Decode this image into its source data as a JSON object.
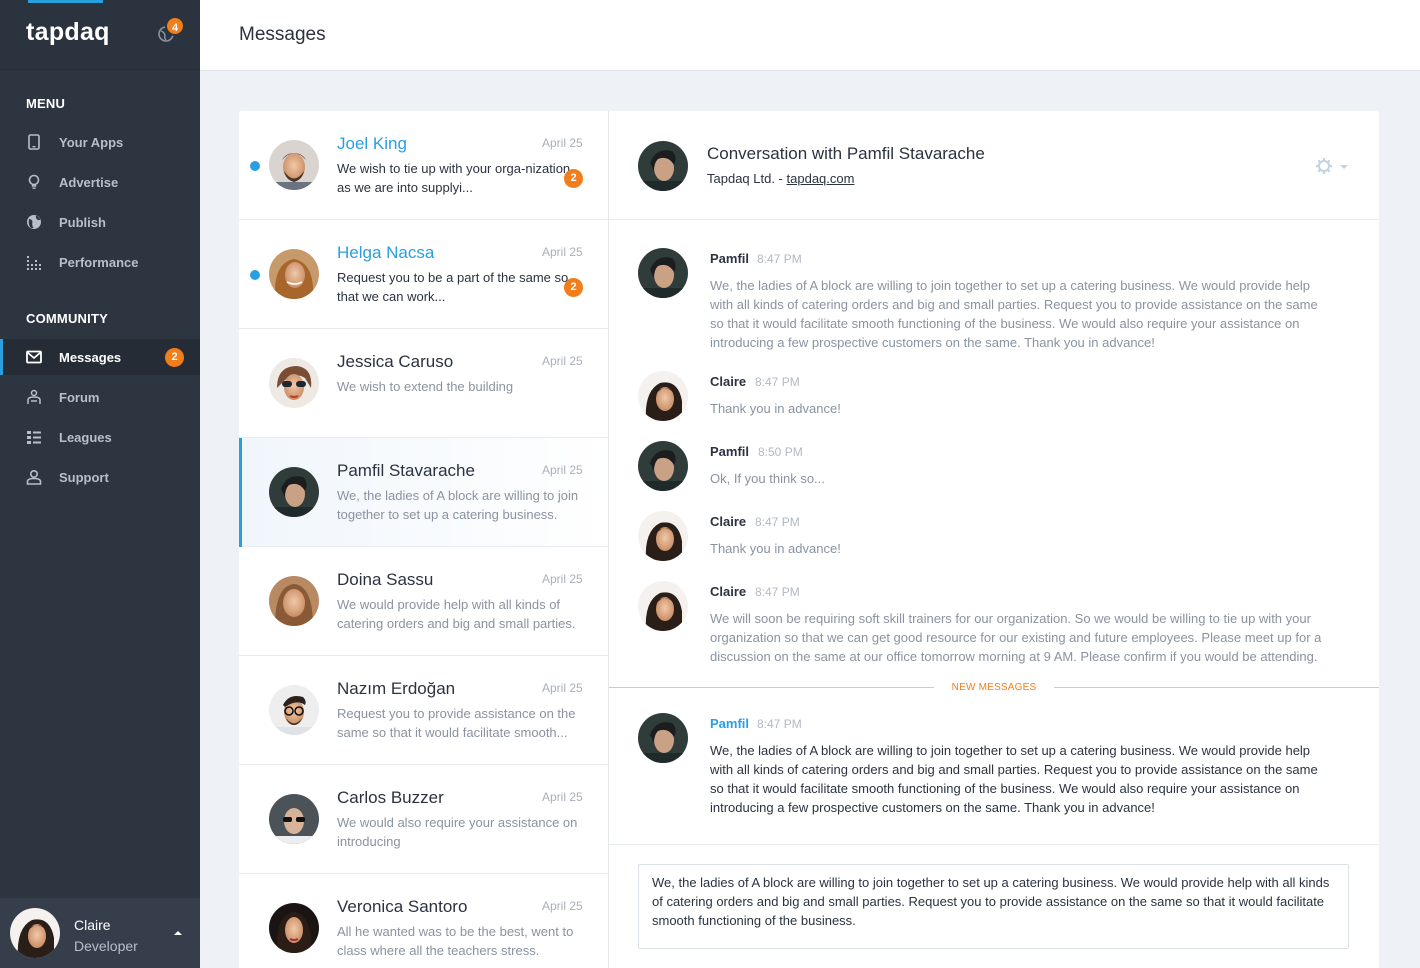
{
  "app": {
    "logo": "tapdaq",
    "notification_count": "4"
  },
  "sidebar": {
    "menu_title": "MENU",
    "menu_items": [
      {
        "label": "Your Apps",
        "icon": "tablet-icon"
      },
      {
        "label": "Advertise",
        "icon": "lightbulb-icon"
      },
      {
        "label": "Publish",
        "icon": "globe-icon"
      },
      {
        "label": "Performance",
        "icon": "chart-dots-icon"
      }
    ],
    "community_title": "COMMUNITY",
    "community_items": [
      {
        "label": "Messages",
        "icon": "envelope-icon",
        "badge": "2",
        "active": true
      },
      {
        "label": "Forum",
        "icon": "forum-icon"
      },
      {
        "label": "Leagues",
        "icon": "list-icon"
      },
      {
        "label": "Support",
        "icon": "support-icon"
      }
    ],
    "profile": {
      "name": "Claire",
      "role": "Developer"
    }
  },
  "header": {
    "title": "Messages"
  },
  "conversations": [
    {
      "name": "Joel King",
      "date": "April 25",
      "preview": "We wish to tie up with your orga-nization as we are into supplyi...",
      "badge": "2",
      "unread": true
    },
    {
      "name": "Helga Nacsa",
      "date": "April 25",
      "preview": "Request you to be a part of the same so that we can work...",
      "badge": "2",
      "unread": true
    },
    {
      "name": "Jessica Caruso",
      "date": "April 25",
      "preview": "We wish to extend the building",
      "unread": false
    },
    {
      "name": "Pamfil Stavarache",
      "date": "April 25",
      "preview": "We, the ladies of A block are willing to join together to set up a catering business.",
      "unread": false,
      "selected": true
    },
    {
      "name": "Doina Sassu",
      "date": "April 25",
      "preview": "We would provide help with all kinds of catering orders and big and small parties.",
      "unread": false
    },
    {
      "name": "Nazım Erdoğan",
      "date": "April 25",
      "preview": "Request you to provide assistance on the same so that it would facilitate smooth...",
      "unread": false
    },
    {
      "name": "Carlos Buzzer",
      "date": "April 25",
      "preview": "We would also require your assistance on introducing",
      "unread": false
    },
    {
      "name": "Veronica Santoro",
      "date": "April 25",
      "preview": "All he wanted was to be the best, went to class where all the teachers stress.",
      "unread": false
    }
  ],
  "chat": {
    "title": "Conversation with Pamfil Stavarache",
    "company": "Tapdaq Ltd. -",
    "company_link": "tapdaq.com",
    "messages": [
      {
        "sender": "Pamfil",
        "time": "8:47 PM",
        "text": "We, the ladies of A block are willing to join together to set up a catering business. We would provide help with all kinds of catering orders and big and small parties. Request you to provide assistance on the same so that it would facilitate smooth functioning of the business. We would also require your assistance on introducing a few prospective customers on the same. Thank you in advance!"
      },
      {
        "sender": "Claire",
        "time": "8:47 PM",
        "text": "Thank you in advance!"
      },
      {
        "sender": "Pamfil",
        "time": "8:50 PM",
        "text": "Ok, If you think so..."
      },
      {
        "sender": "Claire",
        "time": "8:47 PM",
        "text": "Thank you in advance!"
      },
      {
        "sender": "Claire",
        "time": "8:47 PM",
        "text": "We will soon be requiring soft skill trainers for our organization. So we would be willing to tie up with your organization so that we can get good resource for our existing and future employees. Please meet up for a discussion on the same at our office tomorrow morning at 9 AM. Please confirm if you would be attending."
      }
    ],
    "new_messages_label": "NEW MESSAGES",
    "new_messages": [
      {
        "sender": "Pamfil",
        "time": "8:47 PM",
        "text": "We, the ladies of A block are willing to join together to set up a catering business. We would provide help with all kinds of catering orders and big and small parties. Request you to provide assistance on the same so that it would facilitate smooth functioning of the business. We would also require your assistance on introducing a few prospective customers on the same. Thank you in advance!"
      }
    ],
    "compose_value": "We, the ladies of A block are willing to join together to set up a catering business. We would provide help with all kinds of catering orders and big and small parties. Request you to provide assistance on the same so that it would facilitate smooth functioning of the business."
  },
  "colors": {
    "sidebar_bg": "#2d3540",
    "accent_blue": "#2a9fe0",
    "badge_orange": "#f27d1b",
    "page_bg": "#eef1f5"
  }
}
